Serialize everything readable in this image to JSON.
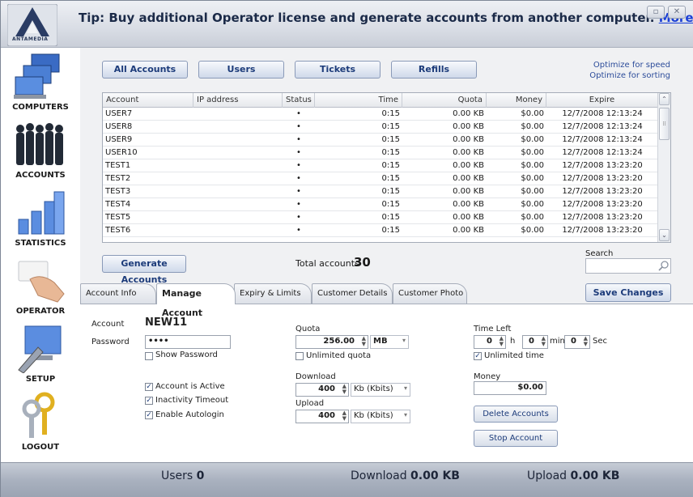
{
  "title_bar": {
    "logo_text": "ANTAMEDIA",
    "tip": "Tip: Buy additional Operator license and generate accounts from another computer.",
    "tip_link": "More Info"
  },
  "sidebar": {
    "items": [
      {
        "label": "COMPUTERS",
        "icon": "computers-icon"
      },
      {
        "label": "ACCOUNTS",
        "icon": "accounts-icon"
      },
      {
        "label": "STATISTICS",
        "icon": "statistics-icon"
      },
      {
        "label": "OPERATOR",
        "icon": "operator-icon"
      },
      {
        "label": "SETUP",
        "icon": "setup-icon"
      },
      {
        "label": "LOGOUT",
        "icon": "logout-icon"
      }
    ]
  },
  "toolbar": {
    "buttons": [
      "All Accounts",
      "Users",
      "Tickets",
      "Refills"
    ],
    "optimize_speed": "Optimize for speed",
    "optimize_sorting": "Optimize for sorting"
  },
  "table": {
    "columns": [
      "Account",
      "IP address",
      "Status",
      "Time",
      "Quota",
      "Money",
      "Expire"
    ],
    "rows": [
      {
        "account": "USER7",
        "ip": "",
        "status": "•",
        "time": "0:15",
        "quota": "0.00 KB",
        "money": "$0.00",
        "expire": "12/7/2008 12:13:24"
      },
      {
        "account": "USER8",
        "ip": "",
        "status": "•",
        "time": "0:15",
        "quota": "0.00 KB",
        "money": "$0.00",
        "expire": "12/7/2008 12:13:24"
      },
      {
        "account": "USER9",
        "ip": "",
        "status": "•",
        "time": "0:15",
        "quota": "0.00 KB",
        "money": "$0.00",
        "expire": "12/7/2008 12:13:24"
      },
      {
        "account": "USER10",
        "ip": "",
        "status": "•",
        "time": "0:15",
        "quota": "0.00 KB",
        "money": "$0.00",
        "expire": "12/7/2008 12:13:24"
      },
      {
        "account": "TEST1",
        "ip": "",
        "status": "•",
        "time": "0:15",
        "quota": "0.00 KB",
        "money": "$0.00",
        "expire": "12/7/2008 13:23:20"
      },
      {
        "account": "TEST2",
        "ip": "",
        "status": "•",
        "time": "0:15",
        "quota": "0.00 KB",
        "money": "$0.00",
        "expire": "12/7/2008 13:23:20"
      },
      {
        "account": "TEST3",
        "ip": "",
        "status": "•",
        "time": "0:15",
        "quota": "0.00 KB",
        "money": "$0.00",
        "expire": "12/7/2008 13:23:20"
      },
      {
        "account": "TEST4",
        "ip": "",
        "status": "•",
        "time": "0:15",
        "quota": "0.00 KB",
        "money": "$0.00",
        "expire": "12/7/2008 13:23:20"
      },
      {
        "account": "TEST5",
        "ip": "",
        "status": "•",
        "time": "0:15",
        "quota": "0.00 KB",
        "money": "$0.00",
        "expire": "12/7/2008 13:23:20"
      },
      {
        "account": "TEST6",
        "ip": "",
        "status": "•",
        "time": "0:15",
        "quota": "0.00 KB",
        "money": "$0.00",
        "expire": "12/7/2008 13:23:20"
      }
    ]
  },
  "generate_button": "Generate Accounts",
  "total": {
    "label": "Total accounts",
    "value": "30"
  },
  "search": {
    "label": "Search",
    "value": ""
  },
  "tabs": [
    "Account Info",
    "Manage Account",
    "Expiry & Limits",
    "Customer Details",
    "Customer Photo"
  ],
  "save_button": "Save Changes",
  "form": {
    "account_label": "Account",
    "account_value": "NEW11",
    "password_label": "Password",
    "password_value": "••••",
    "show_password": "Show Password",
    "account_active": "Account is Active",
    "inactivity_timeout": "Inactivity Timeout",
    "enable_autologin": "Enable Autologin",
    "quota_label": "Quota",
    "quota_value": "256.00",
    "quota_unit": "MB",
    "unlimited_quota": "Unlimited quota",
    "download_label": "Download",
    "download_value": "400",
    "download_unit": "Kb (Kbits)",
    "upload_label": "Upload",
    "upload_value": "400",
    "upload_unit": "Kb (Kbits)",
    "time_left_label": "Time Left",
    "hours": "0",
    "h": "h",
    "minutes": "0",
    "min": "min",
    "seconds": "0",
    "sec": "Sec",
    "unlimited_time": "Unlimited time",
    "money_label": "Money",
    "money_value": "$0.00",
    "delete_accounts": "Delete Accounts",
    "stop_account": "Stop Account"
  },
  "status_bar": {
    "users_label": "Users",
    "users_value": "0",
    "download_label": "Download",
    "download_value": "0.00 KB",
    "upload_label": "Upload",
    "upload_value": "0.00 KB"
  },
  "colors": {
    "accent": "#1c3b7a",
    "link": "#1a3fd6",
    "title_text": "#1b2a48"
  }
}
